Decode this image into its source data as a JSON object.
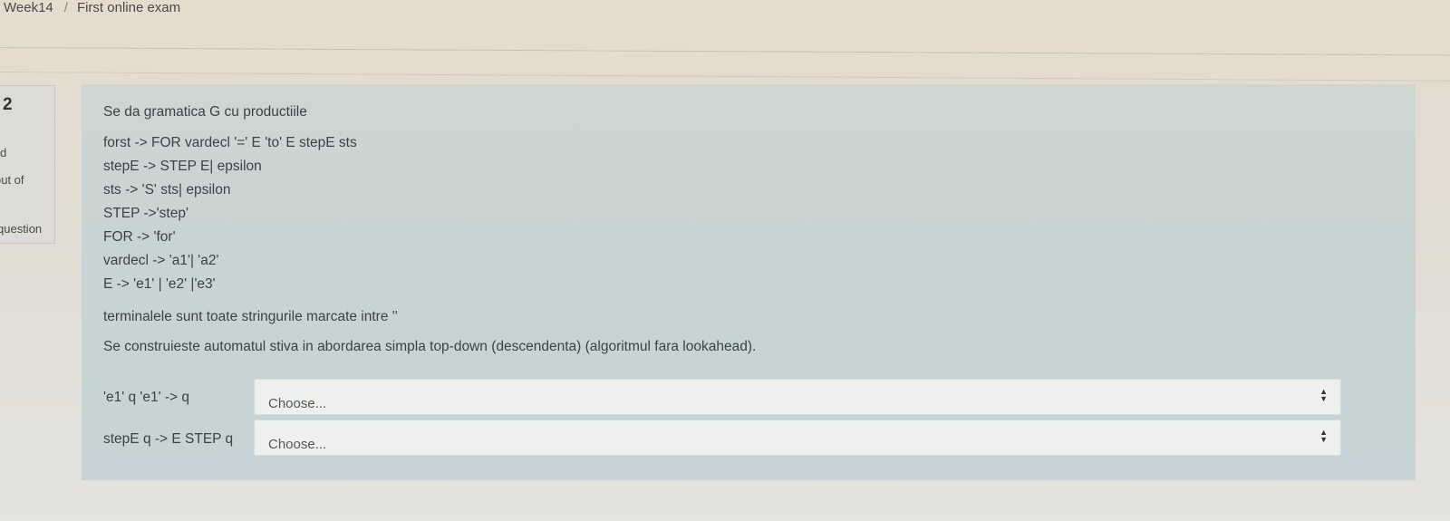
{
  "breadcrumb": {
    "week": "Week14",
    "separator": "/",
    "page": "First online exam"
  },
  "question_info": {
    "number": "2",
    "state": "d",
    "mark": "out of",
    "flag": "question"
  },
  "question": {
    "intro": "Se da gramatica G cu productiile",
    "productions": [
      "forst -> FOR vardecl '=' E 'to' E stepE sts",
      "stepE -> STEP E| epsilon",
      "sts -> 'S' sts| epsilon",
      "STEP ->'step'",
      "FOR -> 'for'",
      "vardecl -> 'a1'| 'a2'",
      "E -> 'e1' | 'e2' |'e3'"
    ],
    "terminals_note": "terminalele sunt toate stringurile marcate intre ''",
    "construction_note": "Se construieste automatul stiva in abordarea simpla top-down (descendenta) (algoritmul fara lookahead)."
  },
  "answers": [
    {
      "label": "'e1' q 'e1' -> q",
      "selected": "Choose..."
    },
    {
      "label": "stepE q -> E STEP q",
      "selected": "Choose..."
    }
  ],
  "icons": {
    "select_arrow": "sort-arrows-icon"
  }
}
